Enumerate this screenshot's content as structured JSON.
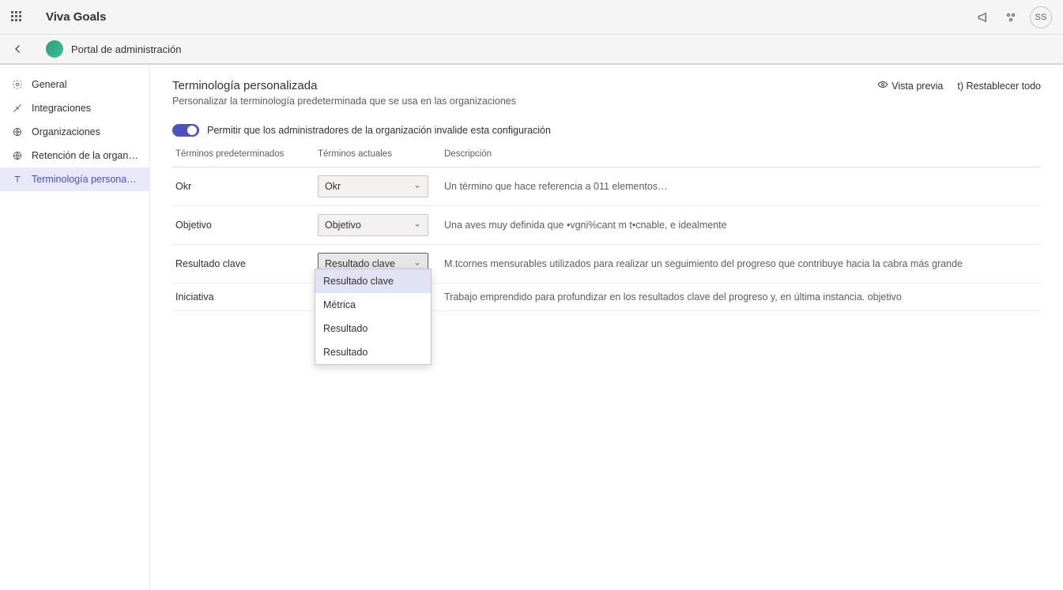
{
  "top": {
    "app_title": "Viva Goals",
    "avatar_initials": "SS"
  },
  "subbar": {
    "title": "Portal de administración"
  },
  "sidebar": {
    "items": [
      {
        "label": "General",
        "icon": "gear"
      },
      {
        "label": "Integraciones",
        "icon": "plug"
      },
      {
        "label": "Organizaciones",
        "icon": "globe"
      },
      {
        "label": "Retención de la organización",
        "icon": "globe"
      },
      {
        "label": "Terminología personalizada",
        "icon": "letter-t"
      }
    ]
  },
  "page": {
    "title": "Terminología personalizada",
    "subtitle": "Personalizar la terminología predeterminada que se usa en las organizaciones",
    "actions": {
      "preview": "Vista previa",
      "reset": "t) Restablecer todo"
    },
    "toggle_label": "Permitir que los administradores de la organización invalide esta configuración"
  },
  "table": {
    "head": {
      "c1": "Términos predeterminados",
      "c2": "Términos actuales",
      "c3": "Descripción"
    },
    "rows": [
      {
        "term": "Okr",
        "current": "Okr",
        "desc": "Un término que hace referencia a 011 elementos…"
      },
      {
        "term": "Objetivo",
        "current": "Objetivo",
        "desc": "Una aves muy definida que •vgni%cant m t•cnable, e idealmente"
      },
      {
        "term": "Resultado clave",
        "current": "Resultado clave",
        "desc": "M.tcornes mensurables utilizados para realizar un seguimiento del progreso que contribuye hacia la cabra más grande"
      },
      {
        "term": "Iniciativa",
        "current": "",
        "desc": "Trabajo emprendido para profundizar en los resultados clave del progreso y, en última instancia. objetivo"
      }
    ]
  },
  "dropdown": {
    "options": [
      "Resultado clave",
      "Métrica",
      "Resultado",
      "Resultado"
    ]
  }
}
